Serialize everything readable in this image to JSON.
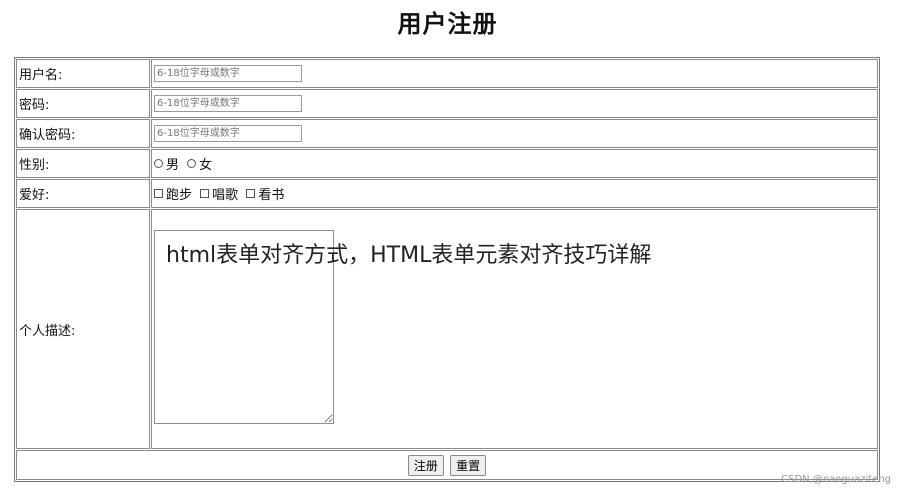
{
  "title": "用户注册",
  "form": {
    "username": {
      "label": "用户名:",
      "placeholder": "6-18位字母或数字"
    },
    "password": {
      "label": "密码:",
      "placeholder": "6-18位字母或数字"
    },
    "confirm": {
      "label": "确认密码:",
      "placeholder": "6-18位字母或数字"
    },
    "gender": {
      "label": "性别:",
      "options": [
        "男",
        "女"
      ]
    },
    "hobbies": {
      "label": "爱好:",
      "options": [
        "跑步",
        "唱歌",
        "看书"
      ]
    },
    "description": {
      "label": "个人描述:"
    },
    "submit_label": "注册",
    "reset_label": "重置"
  },
  "overlay": {
    "headline": "html表单对齐方式，HTML表单元素对齐技巧详解",
    "credit": "CSDN @naoguaziteng"
  }
}
